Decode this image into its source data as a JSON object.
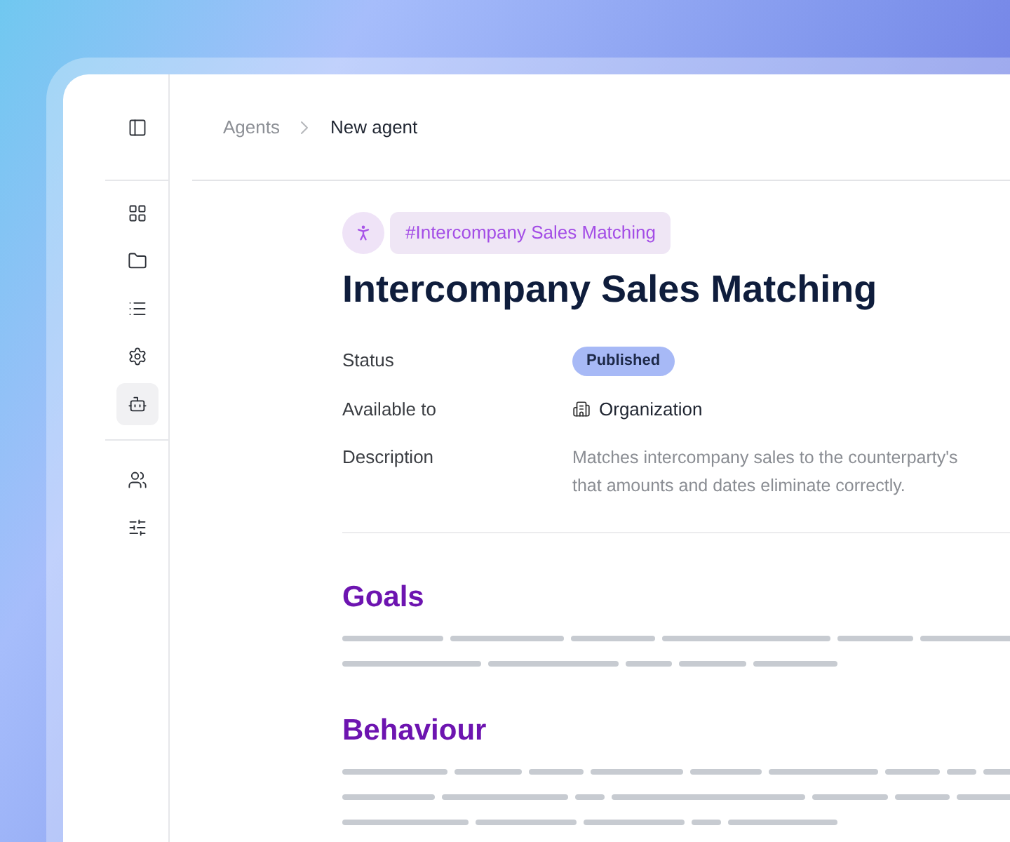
{
  "sidebar": {
    "top": {
      "kind": "panel"
    },
    "items": [
      {
        "kind": "grid",
        "selected": false
      },
      {
        "kind": "folder",
        "selected": false
      },
      {
        "kind": "list",
        "selected": false
      },
      {
        "kind": "gear",
        "selected": false
      },
      {
        "kind": "bot",
        "selected": true
      }
    ],
    "bottom": [
      {
        "kind": "users",
        "selected": false
      },
      {
        "kind": "sliders",
        "selected": false
      }
    ]
  },
  "breadcrumbs": [
    {
      "label": "Agents",
      "current": false
    },
    {
      "label": "New agent",
      "current": true
    }
  ],
  "agent": {
    "tag": "#Intercompany Sales Matching",
    "title": "Intercompany Sales Matching",
    "fields": [
      {
        "label": "Status",
        "kind": "badge",
        "value": "Published"
      },
      {
        "label": "Available to",
        "kind": "org",
        "value": "Organization"
      },
      {
        "label": "Description",
        "kind": "text",
        "lines": [
          "Matches intercompany sales to the counterparty's",
          "that amounts and dates eliminate correctly."
        ]
      }
    ]
  },
  "sections": [
    {
      "heading": "Goals"
    },
    {
      "heading": "Behaviour"
    }
  ]
}
